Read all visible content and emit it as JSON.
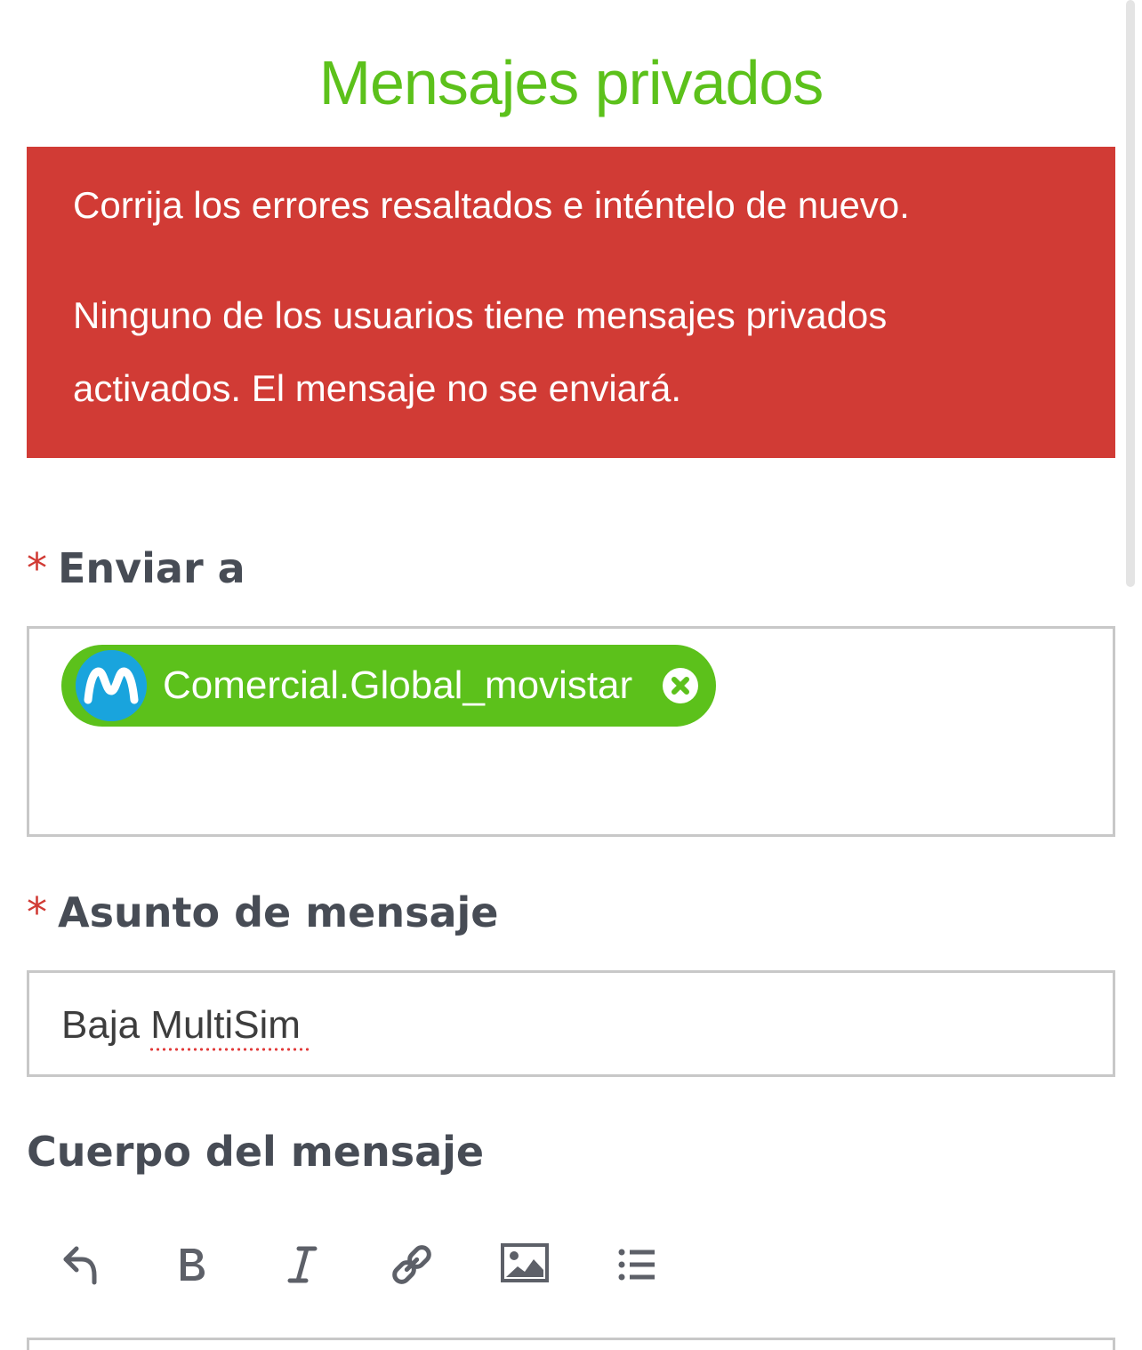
{
  "page": {
    "title": "Mensajes privados"
  },
  "error": {
    "line1": "Corrija los errores resaltados e inténtelo de nuevo.",
    "line2": "Ninguno de los usuarios tiene mensajes privados",
    "line3": "activados. El mensaje no se enviará."
  },
  "form": {
    "required_mark": "*",
    "to_label": "Enviar a",
    "recipients": [
      {
        "name": "Comercial.Global_movistar",
        "avatar_letter": "M",
        "avatar_color": "#19a4dd"
      }
    ],
    "subject_label": "Asunto de mensaje",
    "subject_value": "Baja MultiSim",
    "body_label": "Cuerpo del mensaje"
  },
  "toolbar": {
    "buttons": [
      "undo-icon",
      "bold-icon",
      "italic-icon",
      "link-icon",
      "image-icon",
      "bulleted-list-icon"
    ]
  },
  "colors": {
    "brand_green": "#5cc11b",
    "error_red": "#d13b35",
    "label_gray": "#474c55",
    "icon_gray": "#5d6068"
  }
}
